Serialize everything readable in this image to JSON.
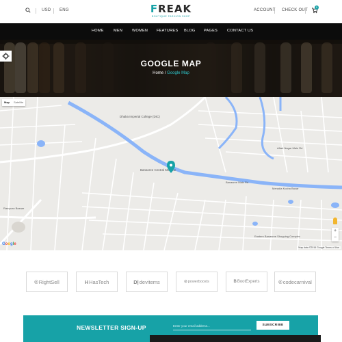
{
  "header": {
    "currency": "USD",
    "language": "ENG",
    "account": "ACCOUNT",
    "checkout": "CHECK OUT",
    "cart_count": "0",
    "logo_main_a": "F",
    "logo_main_b": "REAK",
    "logo_tagline": "BOUTIQUE FASHION SHOP"
  },
  "nav": {
    "items": [
      {
        "label": "HOME"
      },
      {
        "label": "MEN"
      },
      {
        "label": "WOMEN"
      },
      {
        "label": "FEATURES"
      },
      {
        "label": "BLOG"
      },
      {
        "label": "PAGES"
      },
      {
        "label": "CONTACT US"
      }
    ]
  },
  "hero": {
    "title": "GOOGLE MAP",
    "crumb_home": "Home",
    "crumb_sep": " / ",
    "crumb_current": "Google Map"
  },
  "map": {
    "tab_map": "Map",
    "tab_satellite": "Satellite",
    "zoom_in": "+",
    "zoom_out": "−",
    "google_logo": [
      "G",
      "o",
      "o",
      "g",
      "l",
      "e"
    ],
    "attribution": "Map data ©2016 Google   Terms of Use",
    "place_labels": [
      {
        "text": "Dhaka Imperial College (DIC)"
      },
      {
        "text": "Banasree Central Mosque"
      },
      {
        "text": "Aftab Nagar Main Rd"
      },
      {
        "text": "Meradia Kocha Bazar"
      },
      {
        "text": "Eastern Banasree Shopping Complex"
      },
      {
        "text": "Rampura Bazaar"
      },
      {
        "text": "Banasree Main Rd"
      }
    ]
  },
  "brands": [
    {
      "icon": "©",
      "name": "RightSell"
    },
    {
      "icon": "H",
      "name": "HasTech"
    },
    {
      "icon": "D|",
      "name": "devitems"
    },
    {
      "icon": "⊙",
      "name": "powerboosts"
    },
    {
      "icon": "B",
      "name": "BootExperts"
    },
    {
      "icon": "©",
      "name": "codecarnival"
    }
  ],
  "newsletter": {
    "label": "NEWSLETTER SIGN-UP",
    "placeholder": "Enter your email address...",
    "button": "SUBSCRIBE"
  },
  "colors": {
    "accent": "#17a2a7",
    "nav_bg": "#0c0c0c",
    "map_road": "#ffffff",
    "map_water": "#8ab4f8"
  }
}
